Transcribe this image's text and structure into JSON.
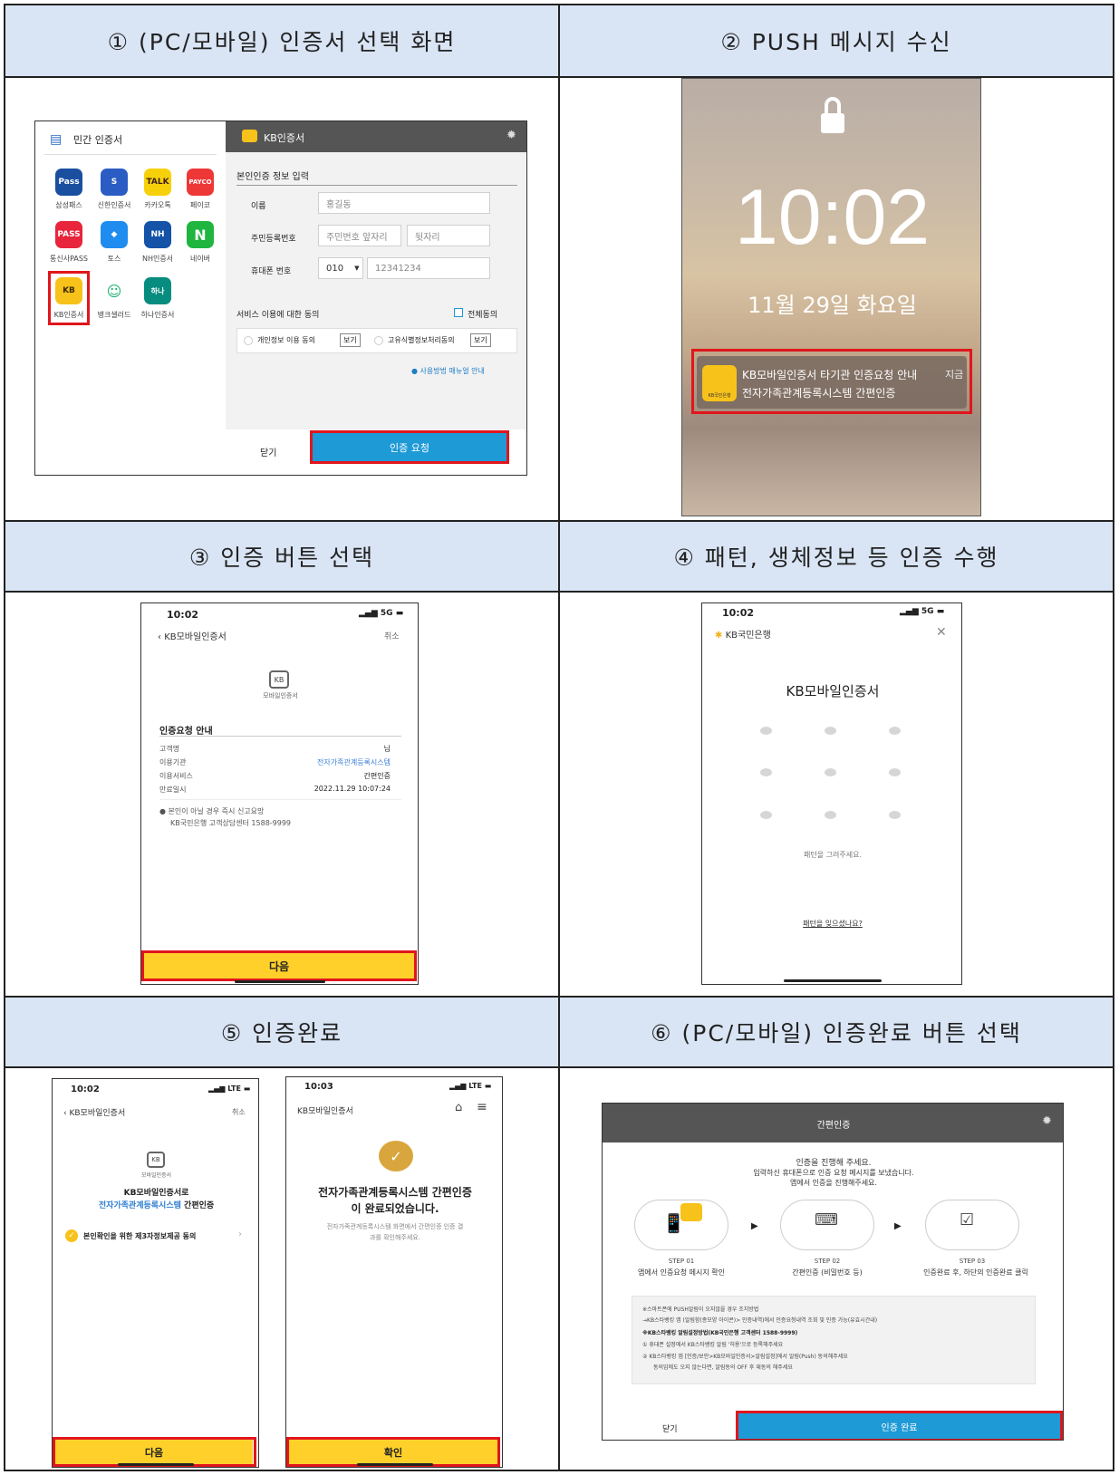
{
  "headers": {
    "h1": "① (PC/모바일) 인증서 선택 화면",
    "h2": "② PUSH 메시지 수신",
    "h3": "③ 인증 버튼 선택",
    "h4": "④ 패턴, 생체정보 등 인증 수행",
    "h5": "⑤ 인증완료",
    "h6": "⑥ (PC/모바일) 인증완료 버튼 선택"
  },
  "step1": {
    "left_title": "민간 인증서",
    "apps": [
      {
        "icon": "Pass",
        "label": "삼성패스",
        "color": "#1a4fa0"
      },
      {
        "icon": "S",
        "label": "신한인증서",
        "color": "#2a5cc4"
      },
      {
        "icon": "TALK",
        "label": "카카오톡",
        "color": "#f6d10a"
      },
      {
        "icon": "PAYCO",
        "label": "페이코",
        "color": "#ee3737"
      },
      {
        "icon": "PASS",
        "label": "통신사PASS",
        "color": "#e8253c"
      },
      {
        "icon": "◆",
        "label": "토스",
        "color": "#1f8cf0"
      },
      {
        "icon": "NH",
        "label": "NH인증서",
        "color": "#1453a8"
      },
      {
        "icon": "N",
        "label": "네이버",
        "color": "#1fb53f"
      },
      {
        "icon": "KB",
        "label": "KB인증서",
        "color": "#f7c21a"
      },
      {
        "icon": "☺",
        "label": "뱅크샐러드",
        "color": "#ffffff"
      },
      {
        "icon": "하나",
        "label": "하나인증서",
        "color": "#078d80"
      }
    ],
    "right_header": "KB인증서",
    "form_title": "본인인증 정보 입력",
    "name_label": "이름",
    "name_value": "홍길동",
    "rrn_label": "주민등록번호",
    "rrn_front": "주민번호 앞자리",
    "rrn_back": "뒷자리",
    "phone_label": "휴대폰 번호",
    "phone_prefix": "010",
    "phone_value": "12341234",
    "agree_title": "서비스 이용에 대한 동의",
    "agree_all": "전체동의",
    "agree1": "개인정보 이용 동의",
    "agree2": "고유식별정보처리동의",
    "view": "보기",
    "manual": "사용방법 매뉴얼 안내",
    "close": "닫기",
    "request": "인증 요청"
  },
  "step2": {
    "time": "10:02",
    "date": "11월 29일 화요일",
    "notif_title": "KB모바일인증서 타기관 인증요청 안내",
    "notif_body": "전자가족관계등록시스템 간편인증",
    "notif_time": "지금",
    "notif_icon": "KB국민은행"
  },
  "step3": {
    "time": "10:02",
    "signal": "5G",
    "back": "KB모바일인증서",
    "cancel": "취소",
    "logo_label": "모바일인증서",
    "section": "인증요청 안내",
    "rows": [
      {
        "k": "고객명",
        "v": "님"
      },
      {
        "k": "이용기관",
        "v": "전자가족관계등록시스템"
      },
      {
        "k": "이용서비스",
        "v": "간편인증"
      },
      {
        "k": "만료일시",
        "v": "2022.11.29 10:07:24"
      }
    ],
    "notice1": "본인이 아닐 경우 즉시 신고요망",
    "notice2": "KB국민은행 고객상담센터 1588-9999",
    "next": "다음"
  },
  "step4": {
    "time": "10:02",
    "signal": "5G",
    "bank": "KB국민은행",
    "title": "KB모바일인증서",
    "hint": "패턴을 그려주세요.",
    "forgot": "패턴을 잊으셨나요?"
  },
  "step5a": {
    "time": "10:02",
    "signal": "LTE",
    "back": "KB모바일인증서",
    "cancel": "취소",
    "logo_label": "모바일인증서",
    "line1": "KB모바일인증서로",
    "line2a": "전자가족관계등록시스템",
    "line2b": "간편인증",
    "consent": "본인확인을 위한 제3자정보제공 동의",
    "next": "다음"
  },
  "step5b": {
    "time": "10:03",
    "signal": "LTE",
    "title": "KB모바일인증서",
    "done1": "전자가족관계등록시스템 간편인증",
    "done2": "이 완료되었습니다.",
    "desc1": "전자가족관계등록시스템 화면에서 간편인증 인증 결",
    "desc2": "과를 확인해주세요.",
    "ok": "확인"
  },
  "step6": {
    "header": "간편인증",
    "intro1": "인증을 진행해 주세요.",
    "intro2": "입력하신 휴대폰으로 인증 요청 메시지를 보냈습니다.",
    "intro3": "앱에서 인증을 진행해주세요.",
    "s1_no": "STEP 01",
    "s1": "앱에서 인증요청 메시지 확인",
    "s2_no": "STEP 02",
    "s2": "간편인증 (비밀번호 등)",
    "s3_no": "STEP 03",
    "s3": "인증완료 후, 하단의 인증완료 클릭",
    "n1": "※스마트폰에 PUSH알림이 오지않을 경우 조치방법",
    "n2": "→KB스타뱅킹 앱 (알림함(종모양 아이콘)> 인증내역)에서 인증요청내역 조회 및 인증 가능(유효시간내)",
    "n3": "※KB스타뱅킹 알림설정방법(KB국민은행 고객센터 1588-9999)",
    "n4": "휴대폰 설정에서 KB스타뱅킹 알림 '허용'으로 등록해주세요",
    "n5": "KB스타뱅킹 앱 [인증/보안>KB모바일인증서>알림설정]에서 알림(Push) 동의해주세요",
    "n6": "동의임에도 오지 않는다면, 알림동의 OFF 후 재동의 해주세요",
    "close": "닫기",
    "complete": "인증 완료"
  }
}
